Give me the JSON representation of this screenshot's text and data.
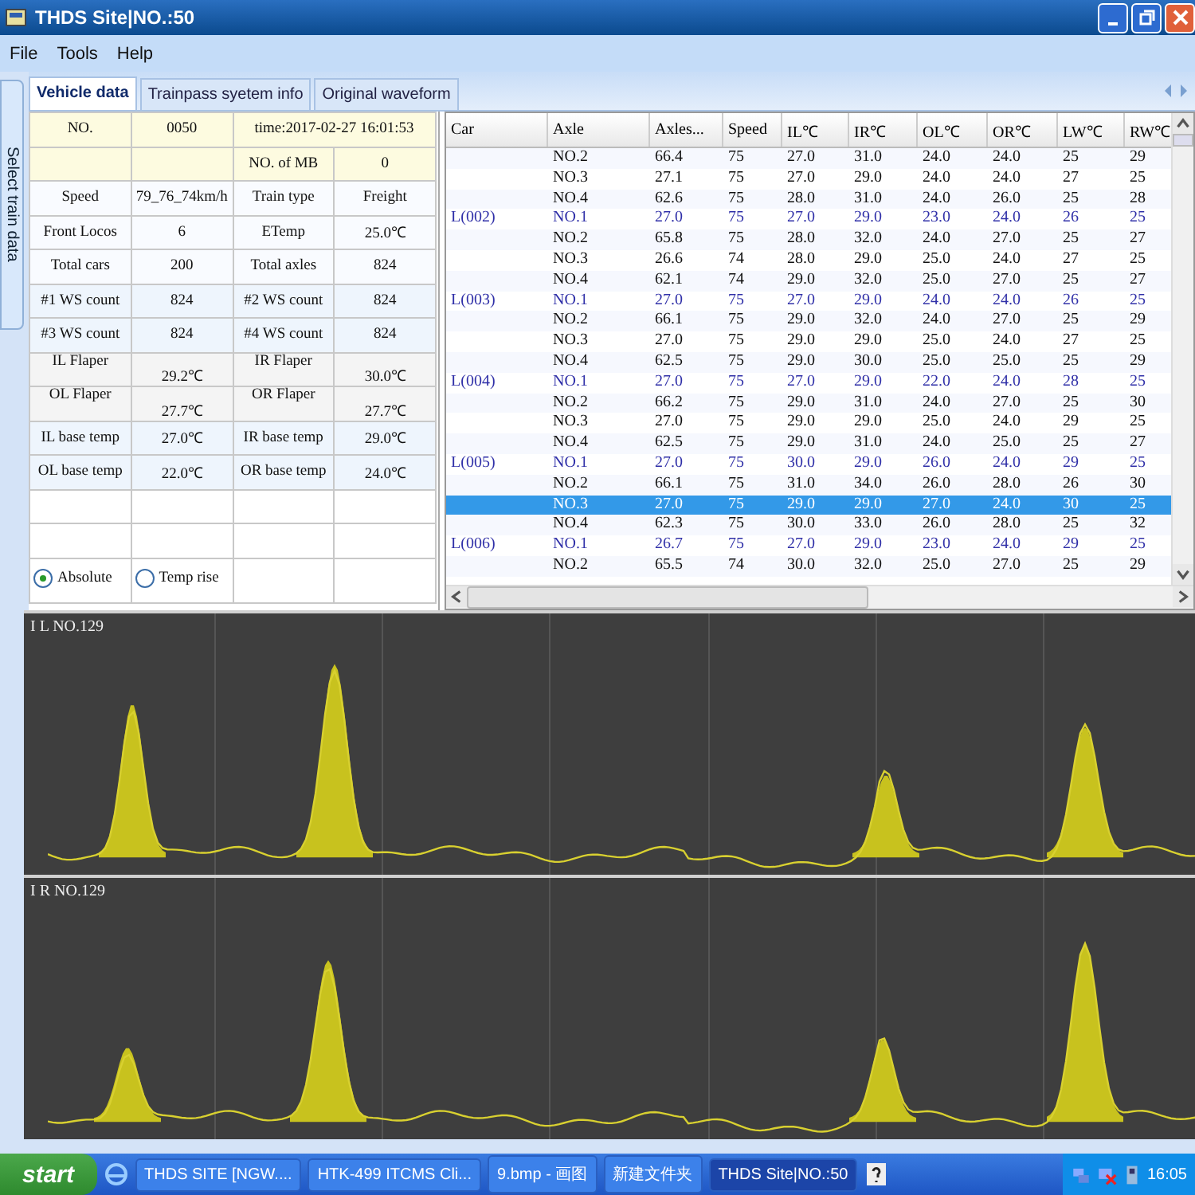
{
  "window": {
    "title": "THDS Site|NO.:50"
  },
  "menu": [
    "File",
    "Tools",
    "Help"
  ],
  "side_tab": {
    "label": "Select train data"
  },
  "tabs": [
    {
      "label": "Vehicle data",
      "selected": true
    },
    {
      "label": "Trainpass syetem info",
      "selected": false
    },
    {
      "label": "Original waveform",
      "selected": false
    }
  ],
  "info_table": {
    "rows": [
      {
        "kind": "header",
        "cells": [
          "NO.",
          "0050",
          {
            "text": "time:2017-02-27 16:01:53",
            "colspan": 2
          }
        ]
      },
      {
        "kind": "header",
        "cells": [
          null,
          null,
          "NO. of MB",
          "0"
        ]
      },
      {
        "kind": "plain",
        "cells": [
          "Speed",
          "79_76_74km/h",
          "Train type",
          "Freight"
        ]
      },
      {
        "kind": "plain",
        "cells": [
          "Front Locos",
          "6",
          "ETemp",
          "25.0℃"
        ]
      },
      {
        "kind": "plain",
        "cells": [
          "Total cars",
          "200",
          "Total axles",
          "824"
        ]
      },
      {
        "kind": "count",
        "cells": [
          "#1 WS count",
          "824",
          "#2 WS count",
          "824"
        ]
      },
      {
        "kind": "count",
        "cells": [
          "#3 WS count",
          "824",
          "#4 WS count",
          "824"
        ]
      },
      {
        "kind": "flaper",
        "cells": [
          "IL Flaper",
          "29.2℃",
          "IR Flaper",
          "30.0℃"
        ]
      },
      {
        "kind": "flaper",
        "cells": [
          "OL Flaper",
          "27.7℃",
          "OR Flaper",
          "27.7℃"
        ]
      },
      {
        "kind": "count",
        "cells": [
          "IL base temp",
          "27.0℃",
          "IR base temp",
          "29.0℃"
        ]
      },
      {
        "kind": "count",
        "cells": [
          "OL base temp",
          "22.0℃",
          "OR base temp",
          "24.0℃"
        ]
      },
      {
        "kind": "blank",
        "cells": []
      },
      {
        "kind": "blank",
        "cells": []
      }
    ],
    "radios": [
      {
        "label": "Absolute",
        "selected": true
      },
      {
        "label": "Temp rise",
        "selected": false
      }
    ]
  },
  "data_table": {
    "columns": [
      "Car",
      "Axle",
      "Axles...",
      "Speed",
      "IL℃",
      "IR℃",
      "OL℃",
      "OR℃",
      "LW℃",
      "RW℃"
    ],
    "rows": [
      {
        "cells": [
          "",
          "NO.2",
          "66.4",
          "75",
          "27.0",
          "31.0",
          "24.0",
          "24.0",
          "25",
          "29"
        ],
        "first_axle": false,
        "selected": false
      },
      {
        "cells": [
          "",
          "NO.3",
          "27.1",
          "75",
          "27.0",
          "29.0",
          "24.0",
          "24.0",
          "27",
          "25"
        ],
        "first_axle": false,
        "selected": false
      },
      {
        "cells": [
          "",
          "NO.4",
          "62.6",
          "75",
          "28.0",
          "31.0",
          "24.0",
          "26.0",
          "25",
          "28"
        ],
        "first_axle": false,
        "selected": false
      },
      {
        "cells": [
          "L(002)",
          "NO.1",
          "27.0",
          "75",
          "27.0",
          "29.0",
          "23.0",
          "24.0",
          "26",
          "25"
        ],
        "first_axle": true,
        "selected": false
      },
      {
        "cells": [
          "",
          "NO.2",
          "65.8",
          "75",
          "28.0",
          "32.0",
          "24.0",
          "27.0",
          "25",
          "27"
        ],
        "first_axle": false,
        "selected": false
      },
      {
        "cells": [
          "",
          "NO.3",
          "26.6",
          "74",
          "28.0",
          "29.0",
          "25.0",
          "24.0",
          "27",
          "25"
        ],
        "first_axle": false,
        "selected": false
      },
      {
        "cells": [
          "",
          "NO.4",
          "62.1",
          "74",
          "29.0",
          "32.0",
          "25.0",
          "27.0",
          "25",
          "27"
        ],
        "first_axle": false,
        "selected": false
      },
      {
        "cells": [
          "L(003)",
          "NO.1",
          "27.0",
          "75",
          "27.0",
          "29.0",
          "24.0",
          "24.0",
          "26",
          "25"
        ],
        "first_axle": true,
        "selected": false
      },
      {
        "cells": [
          "",
          "NO.2",
          "66.1",
          "75",
          "29.0",
          "32.0",
          "24.0",
          "27.0",
          "25",
          "29"
        ],
        "first_axle": false,
        "selected": false
      },
      {
        "cells": [
          "",
          "NO.3",
          "27.0",
          "75",
          "29.0",
          "29.0",
          "25.0",
          "24.0",
          "27",
          "25"
        ],
        "first_axle": false,
        "selected": false
      },
      {
        "cells": [
          "",
          "NO.4",
          "62.5",
          "75",
          "29.0",
          "30.0",
          "25.0",
          "25.0",
          "25",
          "29"
        ],
        "first_axle": false,
        "selected": false
      },
      {
        "cells": [
          "L(004)",
          "NO.1",
          "27.0",
          "75",
          "27.0",
          "29.0",
          "22.0",
          "24.0",
          "28",
          "25"
        ],
        "first_axle": true,
        "selected": false
      },
      {
        "cells": [
          "",
          "NO.2",
          "66.2",
          "75",
          "29.0",
          "31.0",
          "24.0",
          "27.0",
          "25",
          "30"
        ],
        "first_axle": false,
        "selected": false
      },
      {
        "cells": [
          "",
          "NO.3",
          "27.0",
          "75",
          "29.0",
          "29.0",
          "25.0",
          "24.0",
          "29",
          "25"
        ],
        "first_axle": false,
        "selected": false
      },
      {
        "cells": [
          "",
          "NO.4",
          "62.5",
          "75",
          "29.0",
          "31.0",
          "24.0",
          "25.0",
          "25",
          "27"
        ],
        "first_axle": false,
        "selected": false
      },
      {
        "cells": [
          "L(005)",
          "NO.1",
          "27.0",
          "75",
          "30.0",
          "29.0",
          "26.0",
          "24.0",
          "29",
          "25"
        ],
        "first_axle": true,
        "selected": false
      },
      {
        "cells": [
          "",
          "NO.2",
          "66.1",
          "75",
          "31.0",
          "34.0",
          "26.0",
          "28.0",
          "26",
          "30"
        ],
        "first_axle": false,
        "selected": false
      },
      {
        "cells": [
          "",
          "NO.3",
          "27.0",
          "75",
          "29.0",
          "29.0",
          "27.0",
          "24.0",
          "30",
          "25"
        ],
        "first_axle": false,
        "selected": true
      },
      {
        "cells": [
          "",
          "NO.4",
          "62.3",
          "75",
          "30.0",
          "33.0",
          "26.0",
          "28.0",
          "25",
          "32"
        ],
        "first_axle": false,
        "selected": false
      },
      {
        "cells": [
          "L(006)",
          "NO.1",
          "26.7",
          "75",
          "27.0",
          "29.0",
          "23.0",
          "24.0",
          "29",
          "25"
        ],
        "first_axle": true,
        "selected": false
      },
      {
        "cells": [
          "",
          "NO.2",
          "65.5",
          "74",
          "30.0",
          "32.0",
          "25.0",
          "27.0",
          "25",
          "29"
        ],
        "first_axle": false,
        "selected": false
      }
    ]
  },
  "waveforms": [
    {
      "label": "I L NO.129"
    },
    {
      "label": "I R NO.129"
    }
  ],
  "taskbar": {
    "start": "start",
    "items": [
      {
        "label": "THDS SITE [NGW....",
        "selected": false
      },
      {
        "label": "HTK-499 ITCMS Cli...",
        "selected": false
      },
      {
        "label": "9.bmp - 画图",
        "selected": false
      },
      {
        "label": "新建文件夹",
        "selected": false
      },
      {
        "label": "THDS Site|NO.:50",
        "selected": true
      }
    ],
    "clock": "16:05"
  }
}
